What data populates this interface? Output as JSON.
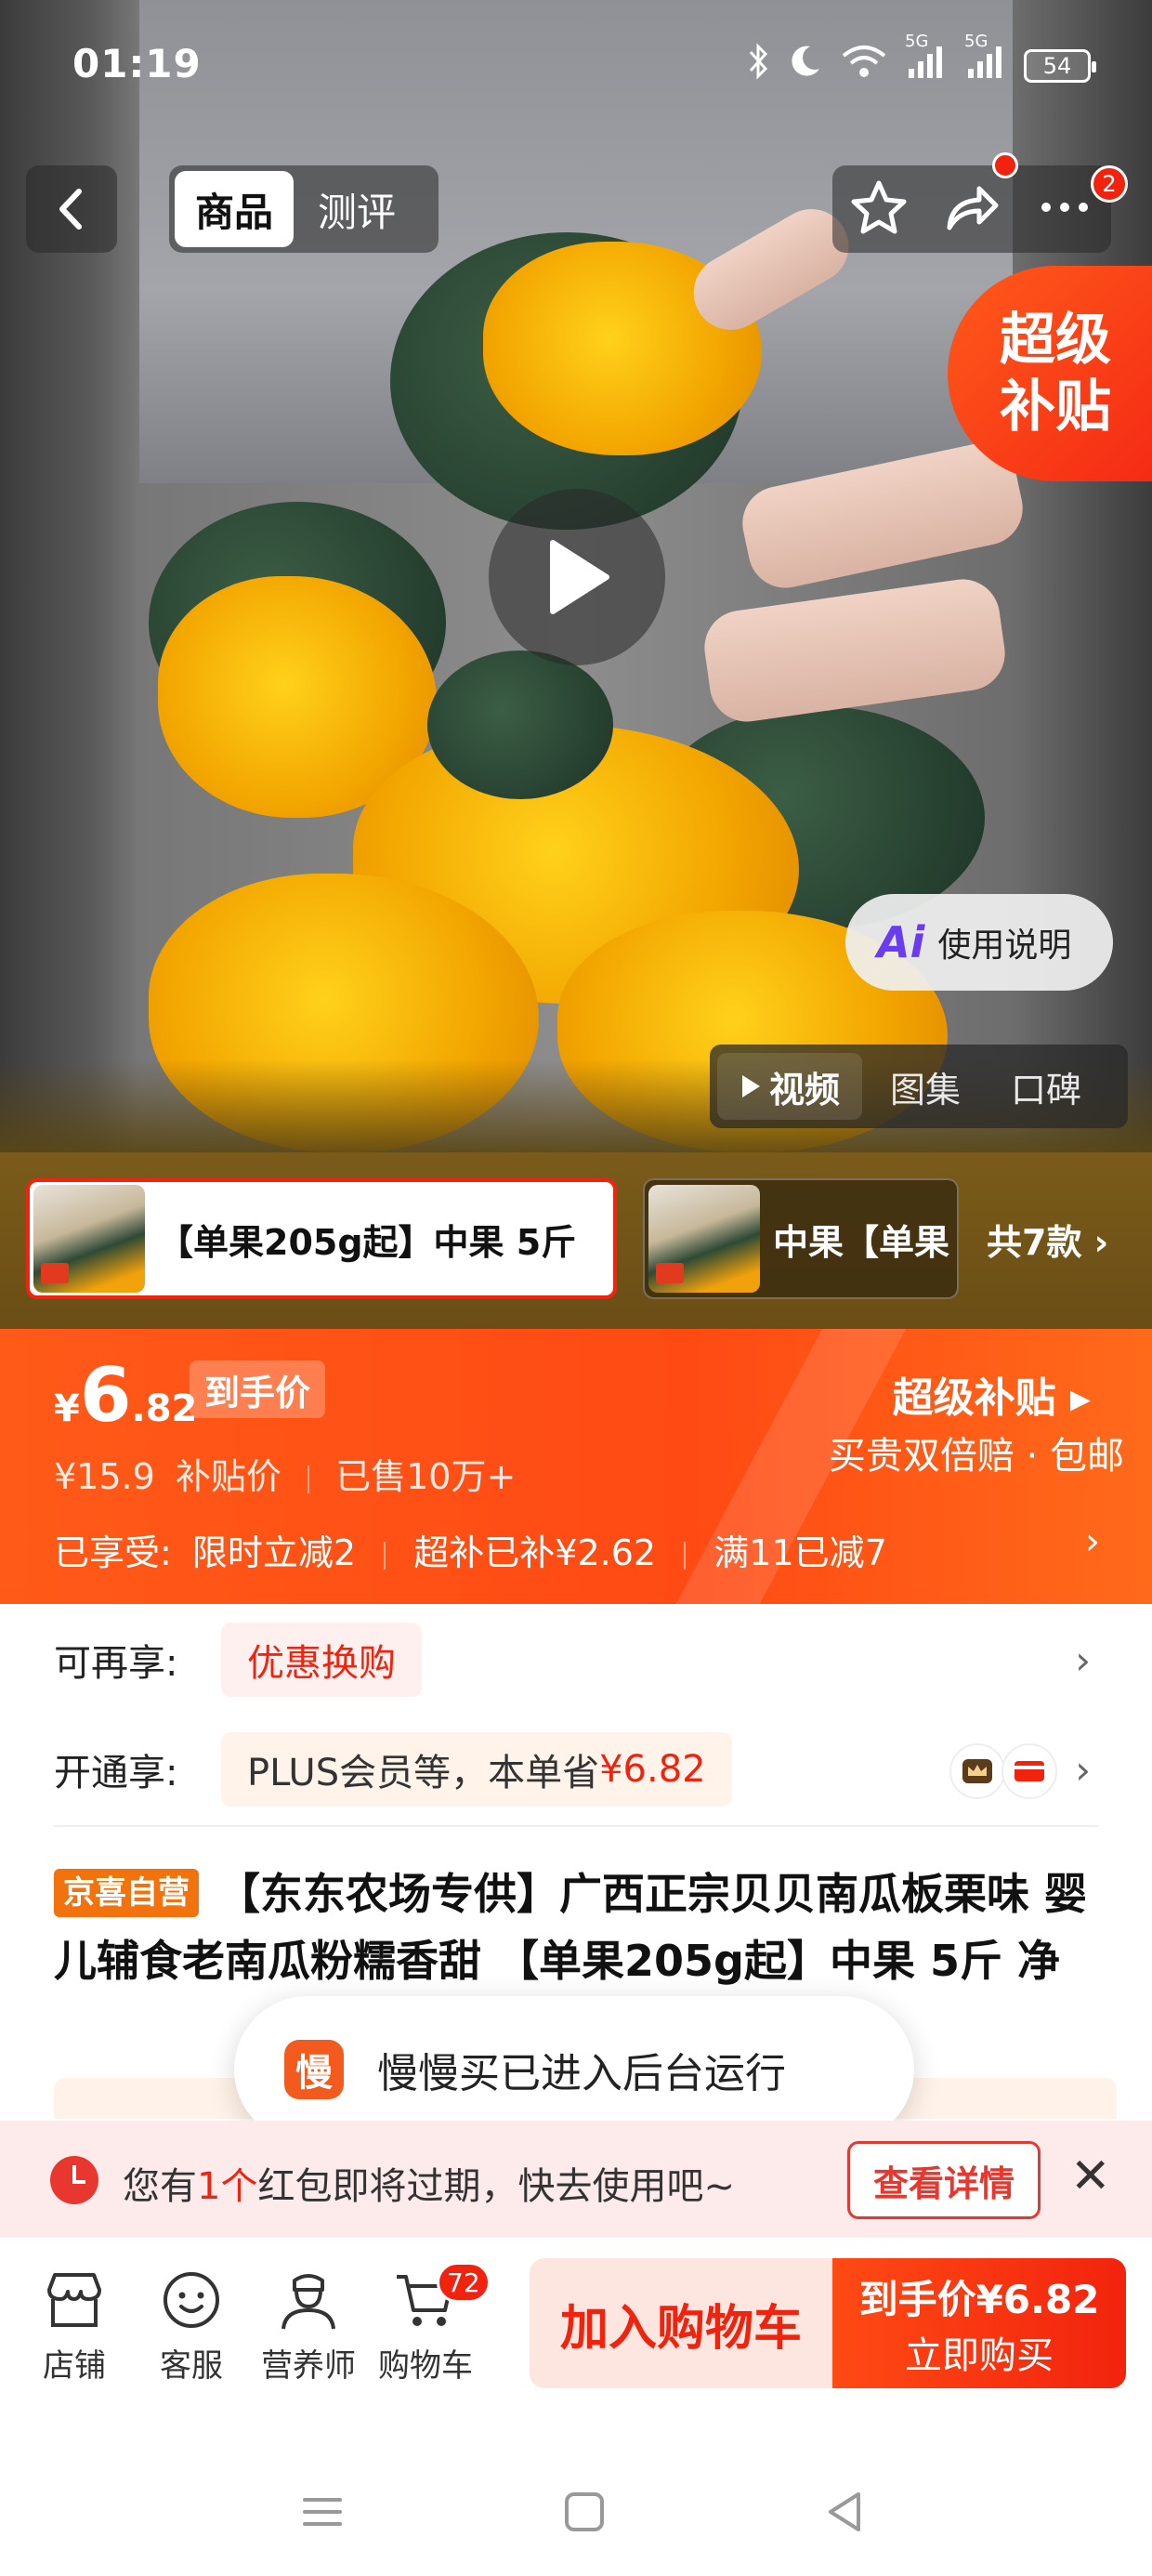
{
  "status_bar": {
    "time": "01:19",
    "battery": "54",
    "network1": "5G",
    "network2": "5G"
  },
  "nav": {
    "tabs": [
      "商品",
      "测评"
    ],
    "active_tab": 0,
    "badge_count": "2"
  },
  "hero": {
    "promo_tag": "超级补贴",
    "ai_button": "使用说明",
    "media_tabs": [
      "视频",
      "图集",
      "口碑"
    ]
  },
  "variants": {
    "items": [
      "【单果205g起】中果 5斤",
      "中果【单果"
    ],
    "count_label": "共7款 ›"
  },
  "price": {
    "currency": "¥",
    "integer": "6",
    "decimal": ".82",
    "tag": "到手价",
    "original": "¥15.9",
    "original_label": "补贴价",
    "sold": "已售10万+",
    "super_subsidy": "超级补贴 ▸",
    "super_note": "买贵双倍赔 · 包邮",
    "enjoyed_label": "已享受:",
    "enjoyed_items": [
      "限时立减2",
      "超补已补¥2.62",
      "满11已减7"
    ]
  },
  "promos": {
    "row1_label": "可再享:",
    "row1_chip": "优惠换购",
    "row2_label": "开通享:",
    "row2_text": "PLUS会员等，本单省",
    "row2_amount": "¥6.82"
  },
  "product": {
    "badge": "京喜自营",
    "title": "【东东农场专供】广西正宗贝贝南瓜板栗味 婴儿辅食老南瓜粉糯香甜 【单果205g起】中果 5斤 净"
  },
  "toast": {
    "icon": "慢",
    "message": "慢慢买已进入后台运行"
  },
  "coupon": {
    "text_prefix": "您有",
    "count": "1个",
    "text_suffix": "红包即将过期，快去使用吧~",
    "button": "查看详情"
  },
  "actions": {
    "store": "店铺",
    "service": "客服",
    "nutritionist": "营养师",
    "cart": "购物车",
    "cart_count": "72",
    "add_to_cart": "加入购物车",
    "buy_price": "到手价¥6.82",
    "buy_label": "立即购买"
  },
  "colors": {
    "accent": "#f2230e",
    "orange": "#ff5a18"
  }
}
